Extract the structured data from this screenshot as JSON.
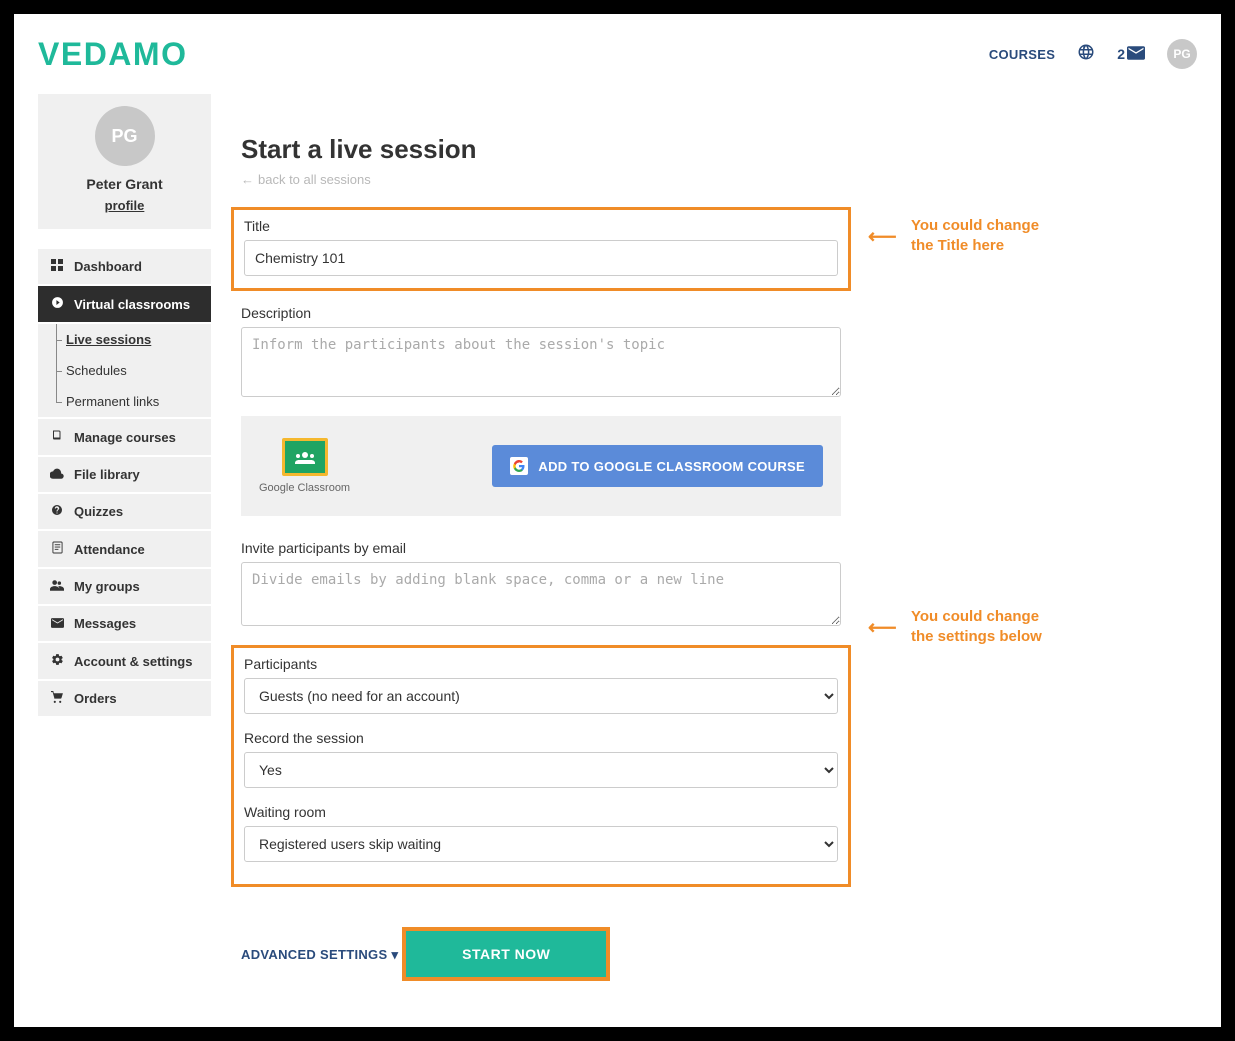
{
  "brand": "VEDAMO",
  "topbar": {
    "courses_label": "COURSES",
    "notif_count": "2",
    "avatar_initials": "PG"
  },
  "profile": {
    "initials": "PG",
    "name": "Peter Grant",
    "profile_link": "profile"
  },
  "nav": {
    "dashboard": "Dashboard",
    "virtual_classrooms": "Virtual classrooms",
    "live_sessions": "Live sessions",
    "schedules": "Schedules",
    "permanent_links": "Permanent links",
    "manage_courses": "Manage courses",
    "file_library": "File library",
    "quizzes": "Quizzes",
    "attendance": "Attendance",
    "my_groups": "My groups",
    "messages": "Messages",
    "account_settings": "Account & settings",
    "orders": "Orders"
  },
  "page": {
    "title": "Start a live session",
    "back": "back to all sessions",
    "title_label": "Title",
    "title_value": "Chemistry 101",
    "description_label": "Description",
    "description_placeholder": "Inform the participants about the session's topic",
    "gc_caption": "Google Classroom",
    "gc_button": "ADD TO GOOGLE CLASSROOM COURSE",
    "invite_label": "Invite participants by email",
    "invite_placeholder": "Divide emails by adding blank space, comma or a new line",
    "participants_label": "Participants",
    "participants_value": "Guests (no need for an account)",
    "record_label": "Record the session",
    "record_value": "Yes",
    "waiting_label": "Waiting room",
    "waiting_value": "Registered users skip waiting",
    "advanced": "ADVANCED SETTINGS",
    "start_button": "START NOW"
  },
  "annotations": {
    "title_note_l1": "You could change",
    "title_note_l2": "the Title here",
    "settings_note_l1": "You could change",
    "settings_note_l2": "the settings below"
  }
}
